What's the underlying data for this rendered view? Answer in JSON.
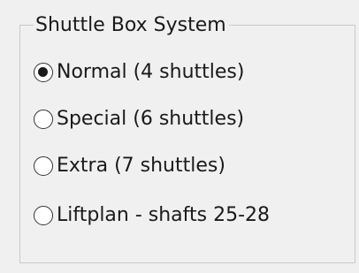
{
  "group": {
    "title": "Shuttle Box System"
  },
  "options": [
    {
      "label": "Normal (4 shuttles)",
      "checked": true
    },
    {
      "label": "Special (6 shuttles)",
      "checked": false
    },
    {
      "label": "Extra (7 shuttles)",
      "checked": false
    },
    {
      "label": "Liftplan - shafts 25-28",
      "checked": false
    }
  ],
  "colors": {
    "background": "#f0f0f0",
    "border": "#c9c9c9",
    "radio_border": "#333333",
    "text": "#1a1a1a"
  }
}
